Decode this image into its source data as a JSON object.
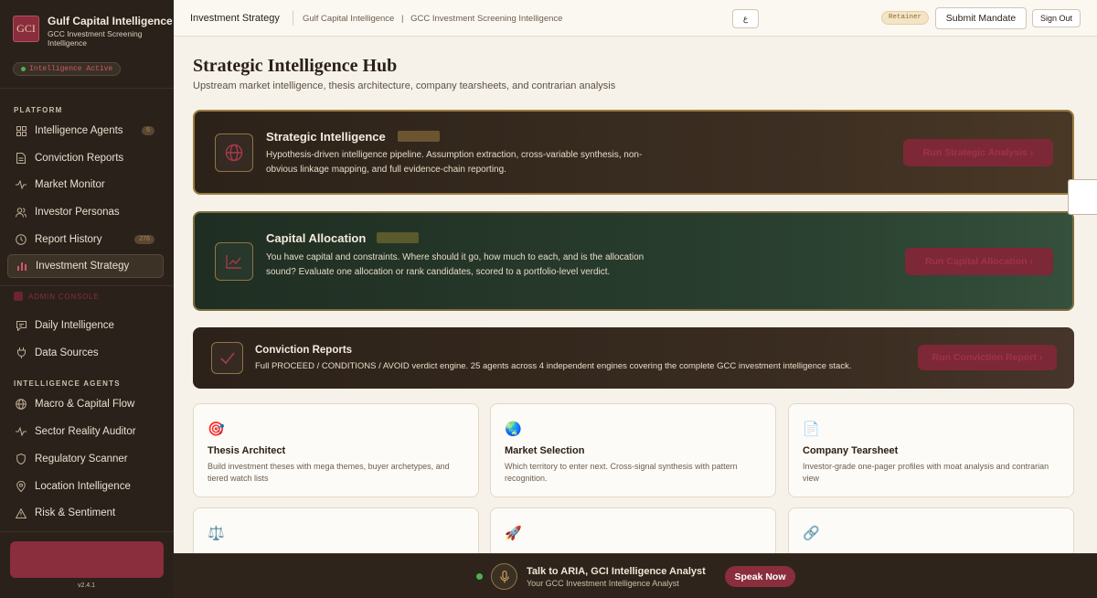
{
  "brand": {
    "logo_text": "GCI",
    "name": "Gulf Capital Intelligence",
    "subtitle": "GCC Investment Screening Intelligence",
    "status": "Intelligence Active"
  },
  "sidebar": {
    "platform_label": "PLATFORM",
    "platform_items": [
      {
        "label": "Intelligence Agents",
        "icon": "grid-icon",
        "badge": "6"
      },
      {
        "label": "Conviction Reports",
        "icon": "document-icon"
      },
      {
        "label": "Market Monitor",
        "icon": "activity-icon"
      },
      {
        "label": "Investor Personas",
        "icon": "users-icon"
      },
      {
        "label": "Report History",
        "icon": "clock-icon",
        "badge": "276"
      },
      {
        "label": "Investment Strategy",
        "icon": "bar-chart-icon",
        "active": true
      }
    ],
    "admin_label": "ADMIN CONSOLE",
    "admin_items": [
      {
        "label": "Daily Intelligence",
        "icon": "message-icon"
      },
      {
        "label": "Data Sources",
        "icon": "plug-icon"
      }
    ],
    "agents_label": "INTELLIGENCE AGENTS",
    "agent_items": [
      {
        "label": "Macro & Capital Flow",
        "icon": "globe-icon"
      },
      {
        "label": "Sector Reality Auditor",
        "icon": "activity-icon"
      },
      {
        "label": "Regulatory Scanner",
        "icon": "shield-icon"
      },
      {
        "label": "Location Intelligence",
        "icon": "pin-icon"
      },
      {
        "label": "Risk & Sentiment",
        "icon": "warning-icon"
      }
    ],
    "version": "v2.4.1"
  },
  "topbar": {
    "title": "Investment Strategy",
    "crumb_1": "Gulf Capital Intelligence",
    "crumb_sep": "|",
    "crumb_2": "GCC Investment Screening Intelligence",
    "lang": "ع",
    "badge": "Retainer",
    "submit_label": "Submit Mandate",
    "signout_label": "Sign Out"
  },
  "main": {
    "title": "Strategic Intelligence Hub",
    "subtitle": "Upstream market intelligence, thesis architecture, company tearsheets, and contrarian analysis",
    "heroes": [
      {
        "title": "Strategic Intelligence",
        "desc": "Hypothesis-driven intelligence pipeline. Assumption extraction, cross-variable synthesis, non-obvious linkage mapping, and full evidence-chain reporting.",
        "button": "Run Strategic Analysis ›",
        "icon": "globe-icon"
      },
      {
        "title": "Capital Allocation",
        "desc": "You have capital and constraints. Where should it go, how much to each, and is the allocation sound? Evaluate one allocation or rank candidates, scored to a portfolio-level verdict.",
        "button": "Run Capital Allocation ›",
        "icon": "line-chart-icon"
      },
      {
        "title": "Conviction Reports",
        "desc": "Full PROCEED / CONDITIONS / AVOID verdict engine. 25 agents across 4 independent engines covering the complete GCC investment intelligence stack.",
        "button": "Run Conviction Report ›",
        "icon": "check-icon"
      }
    ],
    "cards": [
      {
        "icon": "🎯",
        "title": "Thesis Architect",
        "desc": "Build investment theses with mega themes, buyer archetypes, and tiered watch lists"
      },
      {
        "icon": "🌏",
        "title": "Market Selection",
        "desc": "Which territory to enter next. Cross-signal synthesis with pattern recognition."
      },
      {
        "icon": "📄",
        "title": "Company Tearsheet",
        "desc": "Investor-grade one-pager profiles with moat analysis and contrarian view"
      },
      {
        "icon": "⚖️",
        "title": "",
        "desc": ""
      },
      {
        "icon": "🚀",
        "title": "",
        "desc": ""
      },
      {
        "icon": "🔗",
        "title": "",
        "desc": ""
      }
    ]
  },
  "assistant": {
    "title": "Talk to ARIA, GCI Intelligence Analyst",
    "subtitle": "Your GCC Investment Intelligence Analyst",
    "button": "Speak Now"
  },
  "colors": {
    "sidebar_bg": "#2a211b",
    "accent": "#8a2d3c",
    "gold": "#9a7c3e",
    "page_bg": "#f6f2ea",
    "status_green": "#4caf50"
  }
}
